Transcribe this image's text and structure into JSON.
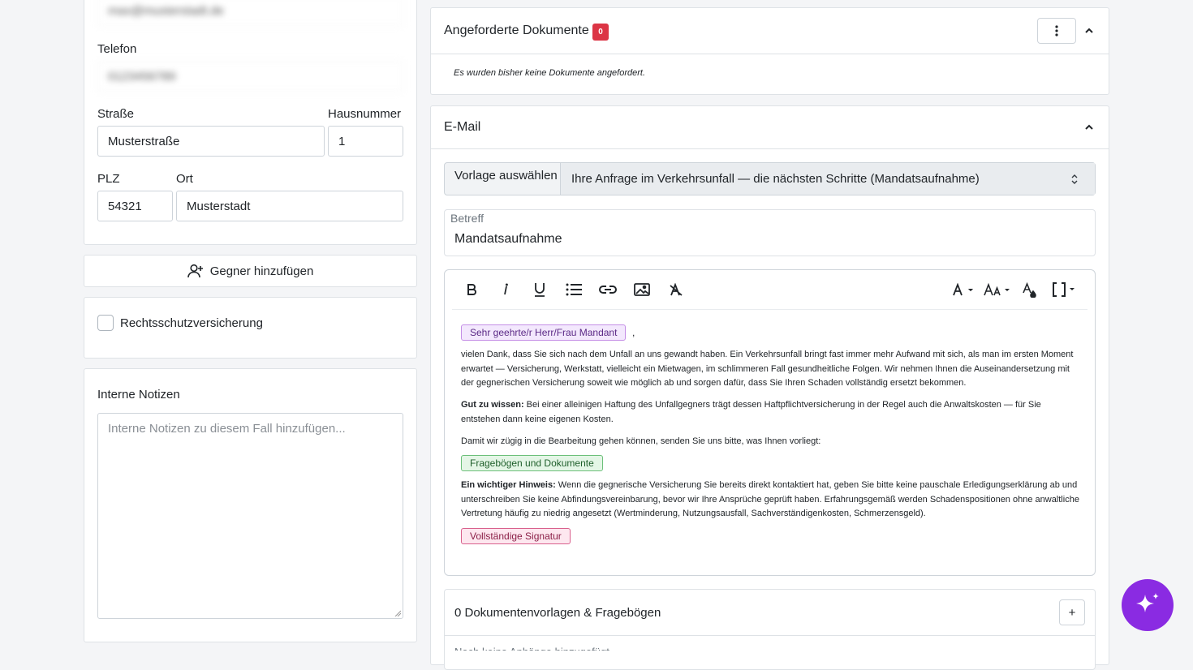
{
  "left": {
    "email_value": "max@musterstadt.de",
    "phone_label": "Telefon",
    "phone_value": "0123456789",
    "street_label": "Straße",
    "street_value": "Musterstraße",
    "housenumber_label": "Hausnummer",
    "housenumber_value": "1",
    "zip_label": "PLZ",
    "zip_value": "54321",
    "city_label": "Ort",
    "city_value": "Musterstadt",
    "add_opponent_label": "Gegner hinzufügen",
    "legal_insurance_label": "Rechtsschutzversicherung",
    "legal_insurance_checked": false,
    "notes_label": "Interne Notizen",
    "notes_placeholder": "Interne Notizen zu diesem Fall hinzufügen..."
  },
  "requested_docs": {
    "title": "Angeforderte Dokumente",
    "count": "0",
    "empty_text": "Es wurden bisher keine Dokumente angefordert."
  },
  "email": {
    "title": "E-Mail",
    "template_label": "Vorlage auswählen",
    "template_selected": "Ihre Anfrage im Verkehrsunfall — die nächsten Schritte (Mandatsaufnahme)",
    "subject_label": "Betreff",
    "subject_value": "Mandatsaufnahme",
    "toolbar": [
      "bold-icon",
      "italic-icon",
      "underline-icon",
      "bullet-list-icon",
      "link-icon",
      "image-icon",
      "clear-format-icon",
      "font-color-icon",
      "font-size-icon",
      "text-color-drop-icon",
      "code-block-icon"
    ],
    "body": {
      "salutation_tag": "Sehr geehrte/r Herr/Frau Mandant",
      "salutation_suffix": ",",
      "para1": "vielen Dank, dass Sie sich nach dem Unfall an uns gewandt haben. Ein Verkehrsunfall bringt fast immer mehr Aufwand mit sich, als man im ersten Moment erwartet — Versicherung, Werkstatt, vielleicht ein Mietwagen, im schlimmeren Fall gesundheitliche Folgen. Wir nehmen Ihnen die Auseinandersetzung mit der gegnerischen Versicherung soweit wie möglich ab und sorgen dafür, dass Sie Ihren Schaden vollständig ersetzt bekommen.",
      "para2_bold": "Gut zu wissen:",
      "para2": " Bei einer alleinigen Haftung des Unfallgegners trägt dessen Haftpflichtversicherung in der Regel auch die Anwaltskosten — für Sie entstehen dann keine eigenen Kosten.",
      "para3": "Damit wir zügig in die Bearbeitung gehen können, senden Sie uns bitte, was Ihnen vorliegt:",
      "docs_tag": "Fragebögen und Dokumente",
      "para4_bold": "Ein wichtiger Hinweis:",
      "para4": " Wenn die gegnerische Versicherung Sie bereits direkt kontaktiert hat, geben Sie bitte keine pauschale Erledigungserklärung ab und unterschreiben Sie keine Abfindungsvereinbarung, bevor wir Ihre Ansprüche geprüft haben. Erfahrungsgemäß werden Schadenspositionen ohne anwaltliche Vertretung häufig zu niedrig angesetzt (Wertminderung, Nutzungsausfall, Sachverständigenkosten, Schmerzensgeld).",
      "signature_tag": "Vollständige Signatur"
    },
    "attachments_title": "0 Dokumentenvorlagen & Fragebögen",
    "attachments_add": "+",
    "attachments_empty": "Noch keine Anhänge hinzugefügt."
  },
  "colors": {
    "salutation_tag_bg": "#f3e8fd",
    "salutation_tag_border": "#c48ee6",
    "docs_tag_bg": "#e4f6e6",
    "docs_tag_border": "#6cc07a",
    "signature_tag_bg": "#fde7ef",
    "signature_tag_border": "#d9608d",
    "badge": "#dc3545",
    "ai_button": "#8a2be2"
  }
}
